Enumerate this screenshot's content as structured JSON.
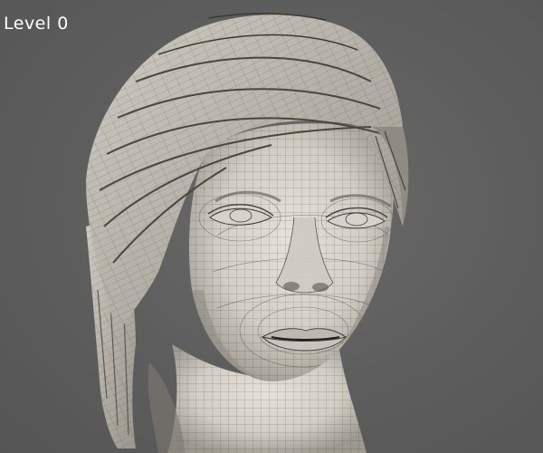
{
  "viewport": {
    "subdivision_label": "Level 0",
    "colors": {
      "background": "#5b5b5b",
      "mesh_fill": "#d8d4cc",
      "mesh_shadow": "#8a867e",
      "wireframe": "#2a2a2a",
      "label_text": "#ffffff"
    }
  }
}
